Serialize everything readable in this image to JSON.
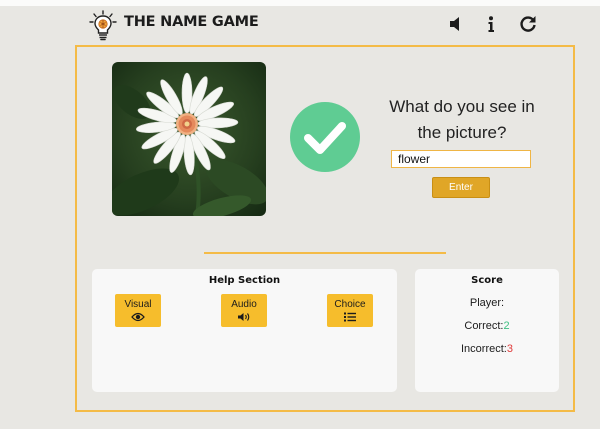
{
  "app": {
    "title": "THE NAME GAME"
  },
  "header_icons": [
    "lightbulb-icon",
    "speaker-icon",
    "info-icon",
    "refresh-icon"
  ],
  "quiz": {
    "question": "What do you see in the picture?",
    "answer_value": "flower",
    "enter_label": "Enter",
    "result_icon": "checkmark-icon",
    "image_subject": "white daisy"
  },
  "help": {
    "title": "Help Section",
    "buttons": [
      {
        "label": "Visual",
        "icon": "eye-icon"
      },
      {
        "label": "Audio",
        "icon": "speaker-icon"
      },
      {
        "label": "Choice",
        "icon": "list-icon"
      }
    ]
  },
  "score": {
    "title": "Score",
    "player_label": "Player:",
    "correct_label": "Correct:",
    "correct_value": "2",
    "incorrect_label": "Incorrect:",
    "incorrect_value": "3"
  },
  "colors": {
    "accent": "#f4bb47",
    "button": "#f6bd2c",
    "enter": "#e0a627",
    "success": "#5fcc93",
    "correct": "#3fbf82",
    "incorrect": "#e03b3b",
    "background": "#e8e7e3"
  }
}
